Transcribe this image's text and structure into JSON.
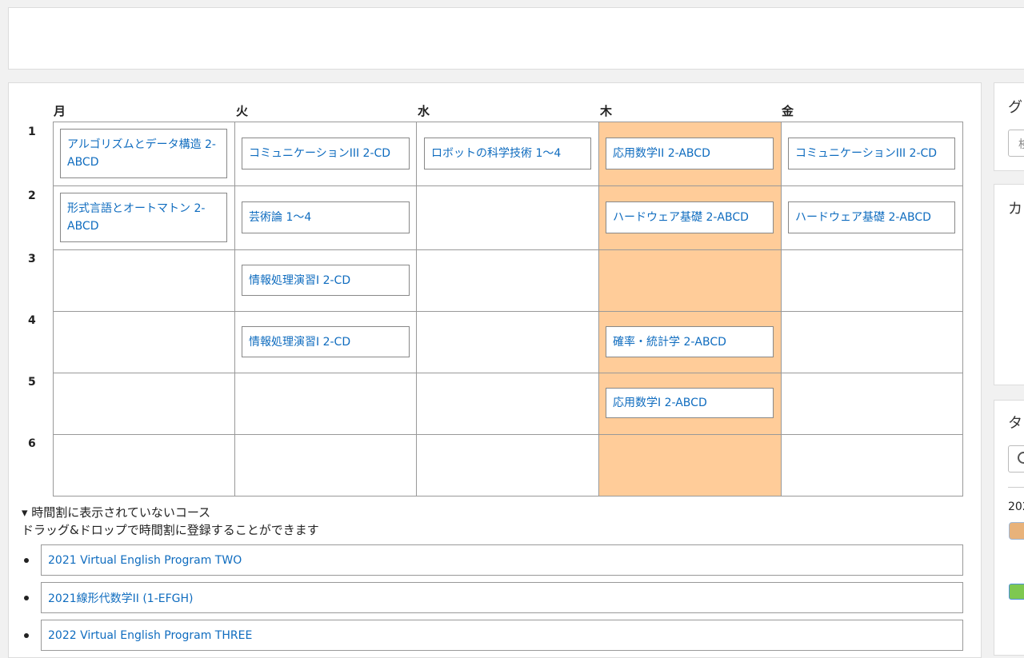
{
  "timetable": {
    "days": [
      "月",
      "火",
      "水",
      "木",
      "金"
    ],
    "periods": [
      "1",
      "2",
      "3",
      "4",
      "5",
      "6"
    ],
    "courses": {
      "mon_p1": "アルゴリズムとデータ構造 2-ABCD",
      "mon_p2": "形式言語とオートマトン 2-ABCD",
      "tue_p1": "コミュニケーションIII 2-CD",
      "tue_p2": "芸術論 1〜4",
      "tue_p3": "情報処理演習I 2-CD",
      "tue_p4": "情報処理演習I 2-CD",
      "wed_p1": "ロボットの科学技術 1〜4",
      "thu_p1": "応用数学II 2-ABCD",
      "thu_p2": "ハードウェア基礎 2-ABCD",
      "thu_p4": "確率・統計学 2-ABCD",
      "thu_p5": "応用数学I 2-ABCD",
      "fri_p1": "コミュニケーションIII 2-CD",
      "fri_p2": "ハードウェア基礎 2-ABCD"
    },
    "highlight_color": "#ffcc99"
  },
  "unlisted": {
    "toggle_label": "▾ 時間割に表示されていないコース",
    "hint": "ドラッグ&ドロップで時間割に登録することができます",
    "items": [
      "2021 Virtual English Program TWO",
      "2021線形代数学II (1-EFGH)",
      "2022 Virtual English Program THREE"
    ]
  },
  "sidebar": {
    "block1_title": "グ",
    "block1_input_text": "検",
    "block2_title": "カ",
    "block3_title": "タ",
    "block3_year": "202"
  },
  "colors": {
    "link": "#0f6cbf",
    "border": "#999999"
  }
}
